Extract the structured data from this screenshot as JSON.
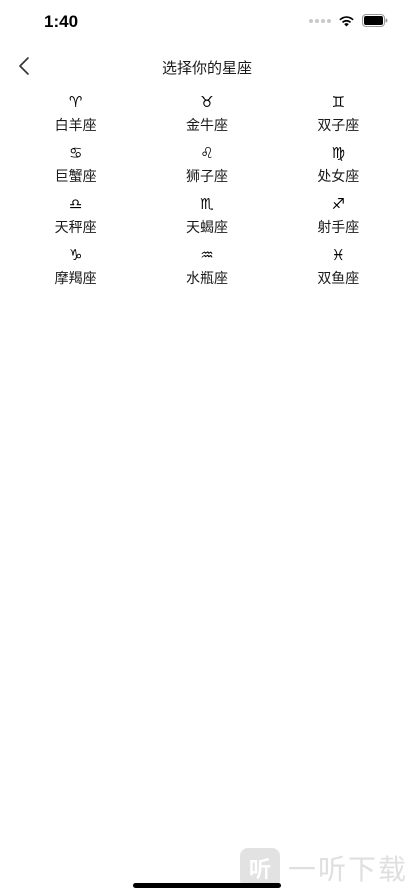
{
  "status_bar": {
    "time": "1:40"
  },
  "nav": {
    "title": "选择你的星座"
  },
  "zodiac": [
    {
      "symbol": "♈",
      "name": "白羊座"
    },
    {
      "symbol": "♉",
      "name": "金牛座"
    },
    {
      "symbol": "♊",
      "name": "双子座"
    },
    {
      "symbol": "♋",
      "name": "巨蟹座"
    },
    {
      "symbol": "♌",
      "name": "狮子座"
    },
    {
      "symbol": "♍",
      "name": "处女座"
    },
    {
      "symbol": "♎",
      "name": "天秤座"
    },
    {
      "symbol": "♏",
      "name": "天蝎座"
    },
    {
      "symbol": "♐",
      "name": "射手座"
    },
    {
      "symbol": "♑",
      "name": "摩羯座"
    },
    {
      "symbol": "♒",
      "name": "水瓶座"
    },
    {
      "symbol": "♓",
      "name": "双鱼座"
    }
  ],
  "watermark": {
    "logo_glyph": "听",
    "text": "一听下载"
  },
  "colors": {
    "background": "#ffffff",
    "text": "#1a1a1a",
    "symbol": "#000000"
  }
}
